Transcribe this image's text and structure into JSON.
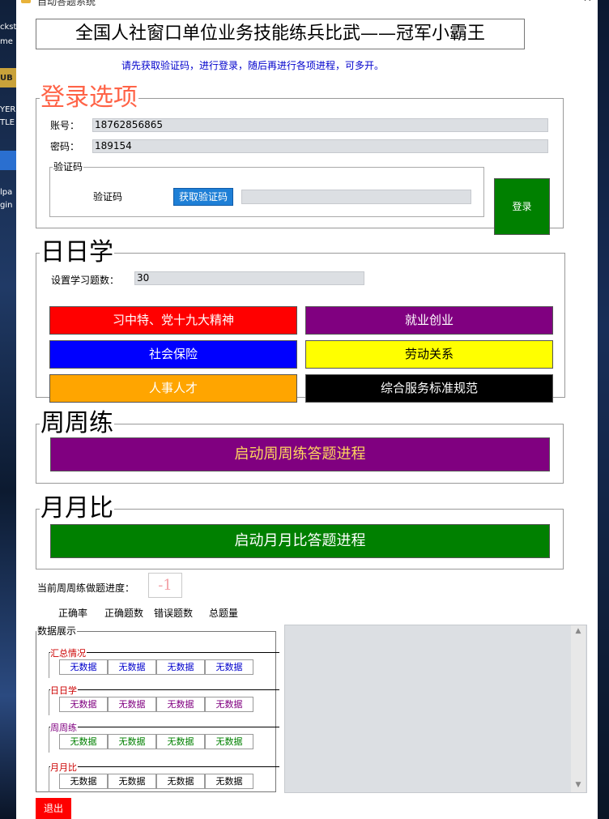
{
  "window": {
    "title": "自动答题系统",
    "minimize": "–",
    "close": "✕"
  },
  "desktop_fragments": [
    "ckst",
    "me",
    "UB",
    "YER",
    "TLE",
    "lpa",
    "gin"
  ],
  "banner": "全国人社窗口单位业务技能练兵比武——冠军小霸王",
  "hint": "请先获取验证码，进行登录，随后再进行各项进程，可多开。",
  "login": {
    "legend": "登录选项",
    "account_label": "账号：",
    "account_value": "18762856865",
    "password_label": "密码：",
    "password_value": "189154",
    "captcha_group": "验证码",
    "captcha_label": "验证码",
    "captcha_button": "获取验证码",
    "captcha_value": "",
    "login_button": "登录"
  },
  "daily": {
    "legend": "日日学",
    "count_label": "设置学习题数：",
    "count_value": "30",
    "buttons": [
      {
        "label": "习中特、党十九大精神",
        "bg": "#ff0000",
        "fg": "#ffffff"
      },
      {
        "label": "就业创业",
        "bg": "#800080",
        "fg": "#ffffff"
      },
      {
        "label": "社会保险",
        "bg": "#0000ff",
        "fg": "#ffffff"
      },
      {
        "label": "劳动关系",
        "bg": "#ffff00",
        "fg": "#000000"
      },
      {
        "label": "人事人才",
        "bg": "#ffa500",
        "fg": "#ffffff"
      },
      {
        "label": "综合服务标准规范",
        "bg": "#000000",
        "fg": "#ffffff"
      }
    ]
  },
  "weekly": {
    "legend": "周周练",
    "button": "启动周周练答题进程",
    "bg": "#800080",
    "fg": "#ffd75e"
  },
  "monthly": {
    "legend": "月月比",
    "button": "启动月月比答题进程",
    "bg": "#008000",
    "fg": "#ffffff"
  },
  "progress": {
    "label": "当前周周练做题进度：",
    "value": "-1"
  },
  "stat_headers": [
    "正确率",
    "正确题数",
    "错误题数",
    "总题量"
  ],
  "data_panel": {
    "legend": "数据展示",
    "sections": [
      {
        "title": "汇总情况",
        "title_color": "#cc0000",
        "value_color": "#0000cc",
        "cells": [
          "无数据",
          "无数据",
          "无数据",
          "无数据"
        ]
      },
      {
        "title": "日日学",
        "title_color": "#cc0000",
        "value_color": "#800080",
        "cells": [
          "无数据",
          "无数据",
          "无数据",
          "无数据"
        ]
      },
      {
        "title": "周周练",
        "title_color": "#800080",
        "value_color": "#008000",
        "cells": [
          "无数据",
          "无数据",
          "无数据",
          "无数据"
        ]
      },
      {
        "title": "月月比",
        "title_color": "#cc0000",
        "value_color": "#000000",
        "cells": [
          "无数据",
          "无数据",
          "无数据",
          "无数据"
        ]
      }
    ]
  },
  "exit_button": "退出"
}
